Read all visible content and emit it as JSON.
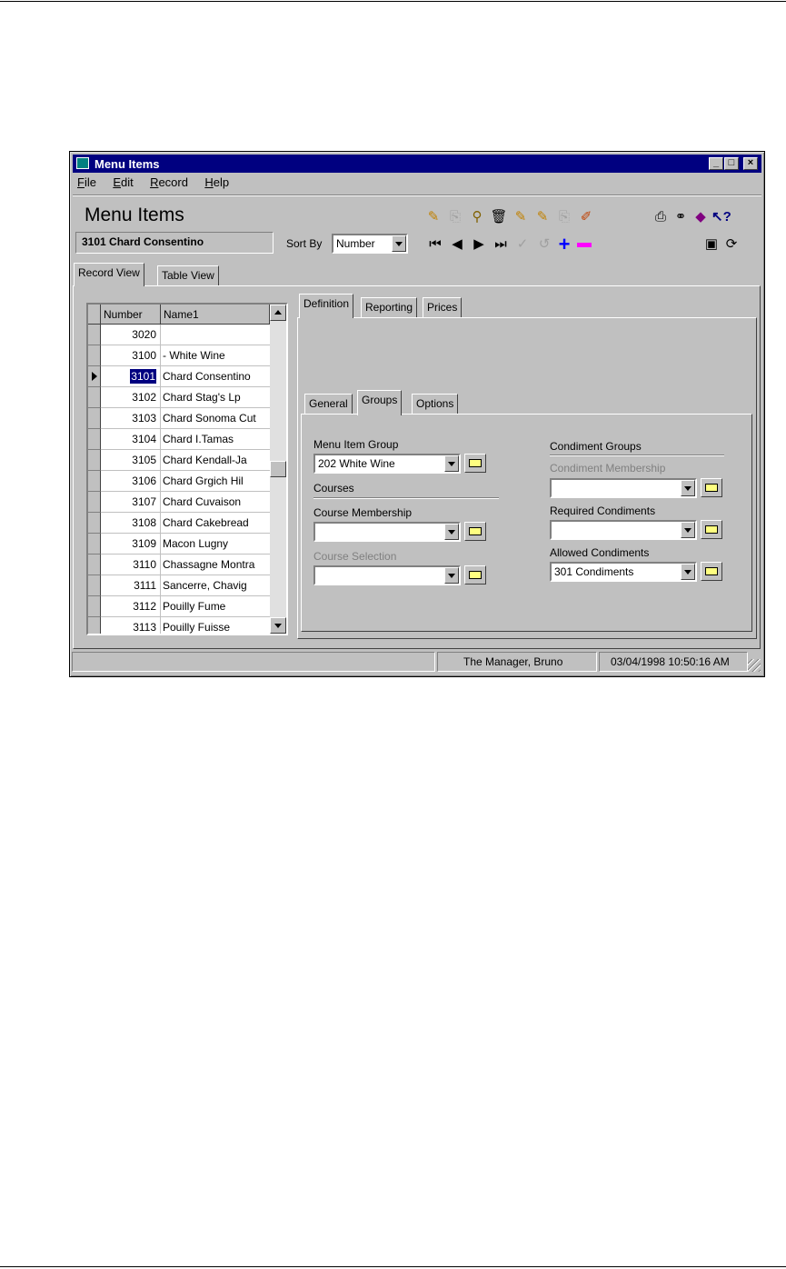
{
  "window": {
    "title": "Menu Items",
    "buttons": {
      "minimize": "_",
      "maximize": "□",
      "close": "×"
    }
  },
  "menubar": {
    "items": [
      {
        "hotkey": "F",
        "rest": "ile"
      },
      {
        "hotkey": "E",
        "rest": "dit"
      },
      {
        "hotkey": "R",
        "rest": "ecord"
      },
      {
        "hotkey": "H",
        "rest": "elp"
      }
    ]
  },
  "header": {
    "title": "Menu Items",
    "current_record": "3101  Chard Consentino",
    "sort_label": "Sort By",
    "sort_value": "Number"
  },
  "main_tabs": [
    "Record View",
    "Table View"
  ],
  "grid": {
    "columns": [
      "Number",
      "Name1"
    ],
    "rows": [
      {
        "number": "3020",
        "name": ""
      },
      {
        "number": "3100",
        "name": "- White Wine"
      },
      {
        "number": "3101",
        "name": "Chard Consentino"
      },
      {
        "number": "3102",
        "name": "Chard Stag's Lp"
      },
      {
        "number": "3103",
        "name": "Chard Sonoma Cut"
      },
      {
        "number": "3104",
        "name": "Chard I.Tamas"
      },
      {
        "number": "3105",
        "name": "Chard Kendall-Ja"
      },
      {
        "number": "3106",
        "name": "Chard Grgich Hil"
      },
      {
        "number": "3107",
        "name": "Chard Cuvaison"
      },
      {
        "number": "3108",
        "name": "Chard Cakebread"
      },
      {
        "number": "3109",
        "name": "Macon Lugny"
      },
      {
        "number": "3110",
        "name": "Chassagne Montra"
      },
      {
        "number": "3111",
        "name": "Sancerre, Chavig"
      },
      {
        "number": "3112",
        "name": "Pouilly Fume"
      },
      {
        "number": "3113",
        "name": "Pouilly Fuisse"
      }
    ],
    "selected_number": "3101"
  },
  "detail_tabs": [
    "Definition",
    "Reporting",
    "Prices"
  ],
  "sub_tabs": [
    "General",
    "Groups",
    "Options"
  ],
  "groups": {
    "menu_item_group_label": "Menu Item Group",
    "menu_item_group_value": "202  White Wine",
    "courses_header": "Courses",
    "course_membership_label": "Course Membership",
    "course_membership_value": "",
    "course_selection_label": "Course Selection",
    "course_selection_value": "",
    "condiment_groups_header": "Condiment Groups",
    "condiment_membership_label": "Condiment Membership",
    "condiment_membership_value": "",
    "required_condiments_label": "Required Condiments",
    "required_condiments_value": "",
    "allowed_condiments_label": "Allowed Condiments",
    "allowed_condiments_value": "301  Condiments"
  },
  "statusbar": {
    "left": "",
    "user": "The Manager, Bruno",
    "datetime": "03/04/1998 10:50:16 AM"
  },
  "colors": {
    "titlebar": "#000080",
    "face": "#c0c0c0",
    "selection": "#000080",
    "add_icon": "#0000ff",
    "remove_icon": "#ff00ff"
  },
  "toolbar_icons": [
    "add-record-icon",
    "copy-record-icon",
    "find-record-icon",
    "delete-icon",
    "renumber-icon",
    "insert-icon",
    "paste-icon",
    "edit-icon",
    "print-icon",
    "find-icon",
    "help-book-icon",
    "context-help-icon",
    "first-record-icon",
    "previous-record-icon",
    "next-record-icon",
    "last-record-icon",
    "confirm-icon",
    "undo-icon",
    "add-row-icon",
    "remove-row-icon",
    "view-icon",
    "refresh-icon"
  ]
}
